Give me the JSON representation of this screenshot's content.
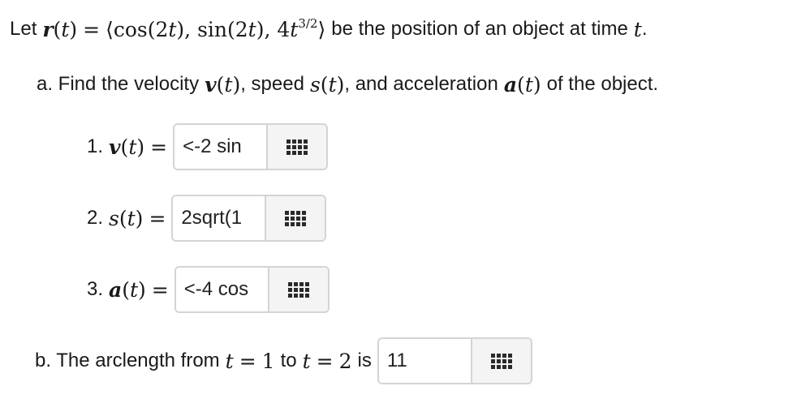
{
  "intro": {
    "lead": "Let",
    "r_symbol": "r",
    "t_var": "(t)",
    "equals": "=",
    "vector_open": "⟨cos(2",
    "t1": "t",
    "mid1": "), sin(2",
    "t2": "t",
    "mid2": "), 4",
    "t3": "t",
    "exponent": "3/2",
    "vector_close": "⟩",
    "tail": "be the position of an object at time",
    "t_end": "t",
    "period": "."
  },
  "part_a": {
    "prefix": "a. Find the velocity",
    "v_symbol": "v",
    "v_arg": "(t)",
    "sep1": ", speed",
    "s_symbol": "s",
    "s_arg": "(t)",
    "sep2": ", and acceleration",
    "a_symbol": "a",
    "a_arg": "(t)",
    "suffix": "of the object."
  },
  "questions": [
    {
      "number": "1.",
      "symbol": "v",
      "arg": "(t)",
      "equals": "=",
      "value": "<-2 sin"
    },
    {
      "number": "2.",
      "symbol": "s",
      "arg": "(t)",
      "equals": "=",
      "value": "2sqrt(1"
    },
    {
      "number": "3.",
      "symbol": "a",
      "arg": "(t)",
      "equals": "=",
      "value": "<-4 cos"
    }
  ],
  "part_b": {
    "prefix": "b. The arclength from",
    "t_var1": "t",
    "eq1": "=",
    "from_value": "1",
    "to_word": "to",
    "t_var2": "t",
    "eq2": "=",
    "to_value": "2",
    "is_word": "is",
    "value": "11"
  },
  "icons": {
    "palette": "grid-palette-icon"
  }
}
